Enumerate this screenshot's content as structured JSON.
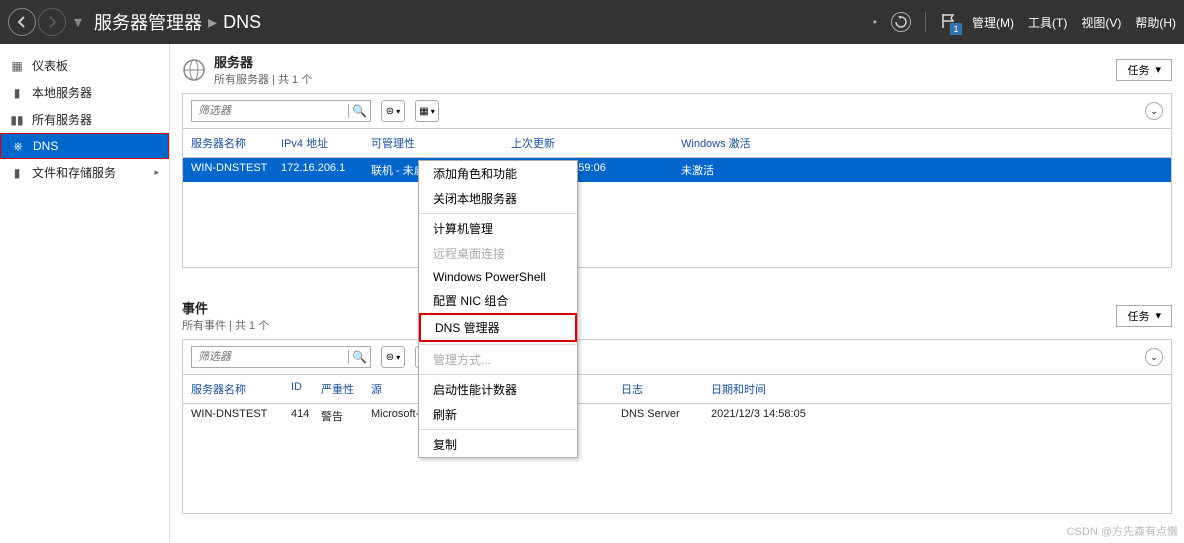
{
  "titlebar": {
    "app": "服务器管理器",
    "crumb": "DNS",
    "menu_manage": "管理(M)",
    "menu_tools": "工具(T)",
    "menu_view": "视图(V)",
    "menu_help": "帮助(H)",
    "flag_count": "1"
  },
  "sidebar": {
    "items": [
      {
        "icon": "▦",
        "label": "仪表板"
      },
      {
        "icon": "▮",
        "label": "本地服务器"
      },
      {
        "icon": "▮▮",
        "label": "所有服务器"
      },
      {
        "icon": "⎈",
        "label": "DNS"
      },
      {
        "icon": "▮",
        "label": "文件和存储服务",
        "expand": "▸"
      }
    ]
  },
  "servers": {
    "title": "服务器",
    "subtitle": "所有服务器 | 共 1 个",
    "tasks": "任务",
    "filter_placeholder": "筛选器",
    "cols": {
      "name": "服务器名称",
      "ip": "IPv4 地址",
      "mgr": "可管理性",
      "upd": "上次更新",
      "act": "Windows 激活"
    },
    "row": {
      "name": "WIN-DNSTEST",
      "ip": "172.16.206.1",
      "mgr": "联机 - 未启动性能计数器",
      "upd": "2021/12/3 14:59:06",
      "act": "未激活"
    }
  },
  "context_menu": {
    "items": [
      {
        "label": "添加角色和功能",
        "enabled": true
      },
      {
        "label": "关闭本地服务器",
        "enabled": true
      },
      {
        "label": "计算机管理",
        "enabled": true,
        "sep_before": true
      },
      {
        "label": "远程桌面连接",
        "enabled": false
      },
      {
        "label": "Windows PowerShell",
        "enabled": true
      },
      {
        "label": "配置 NIC 组合",
        "enabled": true
      },
      {
        "label": "DNS 管理器",
        "enabled": true,
        "highlight": true
      },
      {
        "label": "管理方式...",
        "enabled": false,
        "sep_before": true
      },
      {
        "label": "启动性能计数器",
        "enabled": true,
        "sep_before": true
      },
      {
        "label": "刷新",
        "enabled": true
      },
      {
        "label": "复制",
        "enabled": true,
        "sep_before": true
      }
    ]
  },
  "events": {
    "title": "事件",
    "subtitle": "所有事件 | 共 1 个",
    "tasks": "任务",
    "filter_placeholder": "筛选器",
    "cols": {
      "name": "服务器名称",
      "id": "ID",
      "sev": "严重性",
      "src": "源",
      "log": "日志",
      "dt": "日期和时间"
    },
    "row": {
      "name": "WIN-DNSTEST",
      "id": "414",
      "sev": "警告",
      "src": "Microsoft-Windows-DNS-Server-Service",
      "log": "DNS Server",
      "dt": "2021/12/3 14:58:05"
    }
  },
  "watermark": "CSDN @方先森有点懒"
}
